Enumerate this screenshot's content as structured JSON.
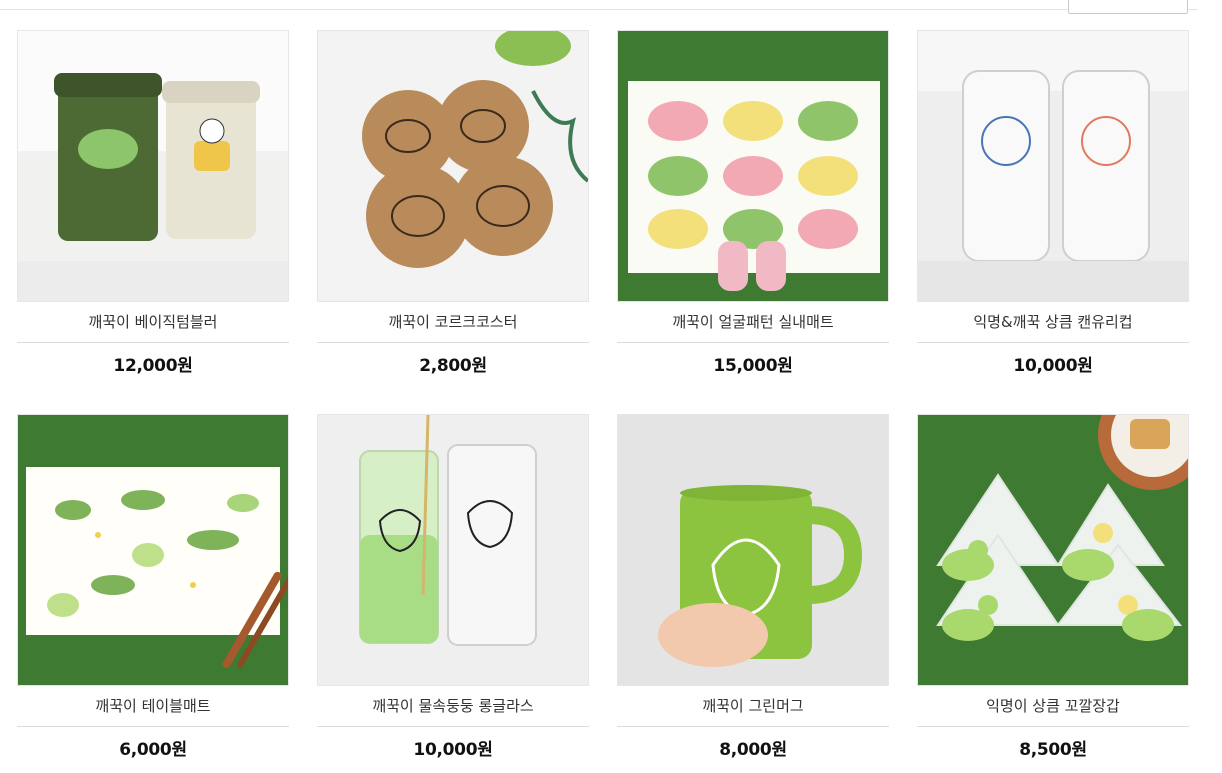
{
  "products": [
    {
      "name": "깨꾹이 베이직텀블러",
      "price": "12,000원"
    },
    {
      "name": "깨꾹이 코르크코스터",
      "price": "2,800원"
    },
    {
      "name": "깨꾹이 얼굴패턴 실내매트",
      "price": "15,000원"
    },
    {
      "name": "익명&깨꾹 상큼 캔유리컵",
      "price": "10,000원"
    },
    {
      "name": "깨꾹이 테이블매트",
      "price": "6,000원"
    },
    {
      "name": "깨꾹이 물속둥둥 롱글라스",
      "price": "10,000원"
    },
    {
      "name": "깨꾹이 그린머그",
      "price": "8,000원"
    },
    {
      "name": "익명이 상큼 꼬깔장갑",
      "price": "8,500원"
    }
  ]
}
